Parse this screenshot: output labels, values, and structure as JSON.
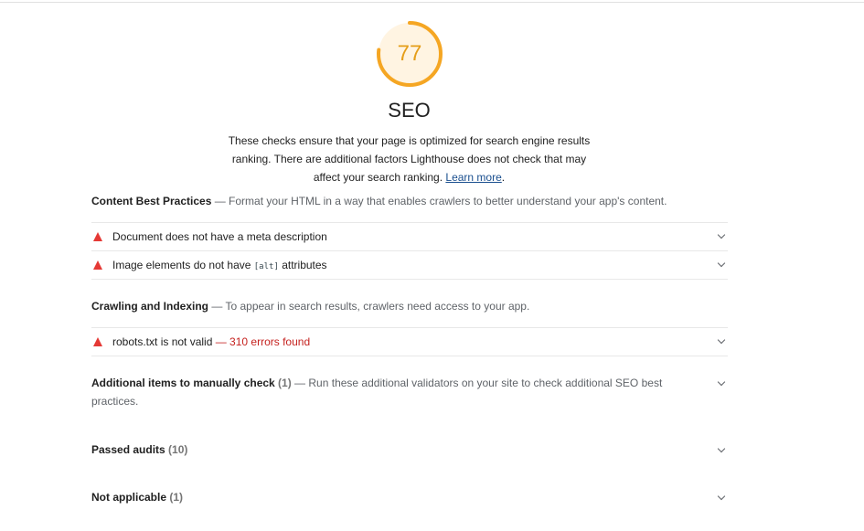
{
  "category": {
    "score": "77",
    "score_fraction": 0.77,
    "gauge_color": "#f5a623",
    "gauge_bg_color": "#fff4e2",
    "title": "SEO",
    "description_prefix": "These checks ensure that your page is optimized for search engine results ranking. There are additional factors Lighthouse does not check that may affect your search ranking. ",
    "learn_more_label": "Learn more",
    "description_suffix": "."
  },
  "groups": {
    "content": {
      "title": "Content Best Practices",
      "separator": " — ",
      "description": "Format your HTML in a way that enables crawlers to better understand your app's content.",
      "audits": [
        {
          "title": "Document does not have a meta description"
        },
        {
          "title_before": "Image elements do not have ",
          "code": "[alt]",
          "title_after": " attributes"
        }
      ]
    },
    "crawling": {
      "title": "Crawling and Indexing",
      "separator": " — ",
      "description": "To appear in search results, crawlers need access to your app.",
      "audits": [
        {
          "title": "robots.txt is not valid",
          "display_value": " — 310 errors found"
        }
      ]
    },
    "manual": {
      "title": "Additional items to manually check",
      "count": " (1)",
      "separator": " — ",
      "description": "Run these additional validators on your site to check additional SEO best practices."
    },
    "passed": {
      "title": "Passed audits",
      "count": " (10)"
    },
    "not_applicable": {
      "title": "Not applicable",
      "count": " (1)"
    }
  },
  "colors": {
    "fail": "#e53935",
    "average": "#e59e1a",
    "link": "#1a4f8f"
  }
}
